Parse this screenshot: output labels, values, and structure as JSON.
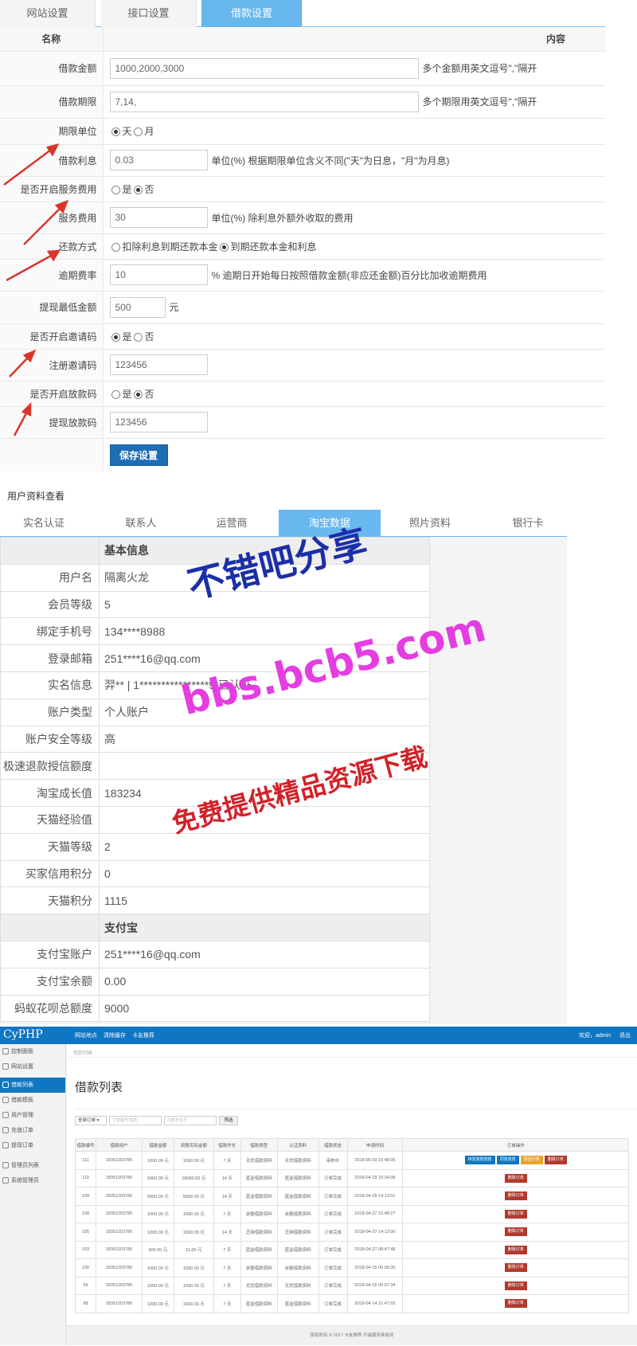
{
  "settings": {
    "tabs": [
      "网站设置",
      "接口设置",
      "借款设置"
    ],
    "header": {
      "name": "名称",
      "content": "内容"
    },
    "amount": {
      "label": "借款金额",
      "value": "1000,2000,3000",
      "hint": "多个金额用英文逗号\",\"隔开"
    },
    "period": {
      "label": "借款期限",
      "value": "7,14,",
      "hint": "多个期限用英文逗号\",\"隔开"
    },
    "unit": {
      "label": "期限单位",
      "opt1": "天",
      "opt2": "月"
    },
    "interest": {
      "label": "借款利息",
      "value": "0.03",
      "hint": "单位(%) 根据期限单位含义不同(\"天\"为日息，\"月\"为月息)"
    },
    "service_enabled": {
      "label": "是否开启服务费用",
      "opt1": "是",
      "opt2": "否"
    },
    "service_fee": {
      "label": "服务费用",
      "value": "30",
      "hint": "单位(%) 除利息外额外收取的费用"
    },
    "repay": {
      "label": "还款方式",
      "opt1": "扣除利息到期还款本金",
      "opt2": "到期还款本金和利息"
    },
    "overdue": {
      "label": "逾期费率",
      "value": "10",
      "hint": "% 逾期日开始每日按照借款金额(非应还金额)百分比加收逾期费用"
    },
    "min_withdraw": {
      "label": "提现最低金额",
      "value": "500",
      "unit": "元"
    },
    "invite_enabled": {
      "label": "是否开启邀请码",
      "opt1": "是",
      "opt2": "否"
    },
    "invite_code": {
      "label": "注册邀请码",
      "value": "123456"
    },
    "release_enabled": {
      "label": "是否开启放款码",
      "opt1": "是",
      "opt2": "否"
    },
    "release_code": {
      "label": "提现放款码",
      "value": "123456"
    },
    "save_label": "保存设置"
  },
  "profile": {
    "title": "用户资料查看",
    "tabs": [
      "实名认证",
      "联系人",
      "运营商",
      "淘宝数据",
      "照片资料",
      "银行卡"
    ],
    "section1": "基本信息",
    "rows1": [
      {
        "k": "用户名",
        "v": "隔离火龙"
      },
      {
        "k": "会员等级",
        "v": "5"
      },
      {
        "k": "绑定手机号",
        "v": "134****8988"
      },
      {
        "k": "登录邮箱",
        "v": "251****16@qq.com"
      },
      {
        "k": "实名信息",
        "v": "羿** | 1****************9 已认证"
      },
      {
        "k": "账户类型",
        "v": "个人账户"
      },
      {
        "k": "账户安全等级",
        "v": "高"
      },
      {
        "k": "极速退款授信额度",
        "v": ""
      },
      {
        "k": "淘宝成长值",
        "v": "183234"
      },
      {
        "k": "天猫经验值",
        "v": ""
      },
      {
        "k": "天猫等级",
        "v": "2"
      },
      {
        "k": "买家信用积分",
        "v": "0"
      },
      {
        "k": "天猫积分",
        "v": "1115"
      }
    ],
    "section2": "支付宝",
    "rows2": [
      {
        "k": "支付宝账户",
        "v": "251****16@qq.com"
      },
      {
        "k": "支付宝余额",
        "v": "0.00"
      },
      {
        "k": "蚂蚁花呗总额度",
        "v": "9000"
      }
    ]
  },
  "watermark": {
    "line1": "不错吧分享",
    "line2": "bbs.bcb5.com",
    "line3": "免费提供精品资源下载"
  },
  "admin": {
    "logo": "CyPHP",
    "topnav": [
      "网站地点",
      "清除缓存",
      "卡友推荐"
    ],
    "welcome": "欢迎，admin",
    "logout": "退出",
    "breadcrumb": "借款列表",
    "page_title": "借款列表",
    "filter": {
      "select": "全部订单 ▾",
      "ph1": "订单编号/借款",
      "ph2": "注册手机号",
      "button": "筛选"
    },
    "sidebar": [
      "控制面板",
      "网站设置",
      "借款列表",
      "借款模板",
      "用户管理",
      "充值订单",
      "提现订单",
      "管理员列表",
      "系统管理员"
    ],
    "columns": [
      "借款编号",
      "借款用户",
      "借款金额",
      "到账实际金额",
      "借款时长",
      "借款类型",
      "认证资料",
      "借款状态",
      "申请时间",
      "订单操作"
    ],
    "rows": [
      [
        "111",
        "18351203780",
        "1000.00 元",
        "1000.00 元",
        "7 天",
        "无忧借款资料",
        "无忧借款资料",
        "审核中",
        "2018-05-03 15:48:06"
      ],
      [
        "110",
        "18351203780",
        "5000.00 元",
        "18000.00 元",
        "14 天",
        "蓝金借款资料",
        "蓝金借款资料",
        "订单完成",
        "2018-04-29 15:34:08"
      ],
      [
        "109",
        "18351203780",
        "5000.00 元",
        "5000.00 元",
        "14 天",
        "蓝金借款资料",
        "蓝金借款资料",
        "订单完成",
        "2018-04-29 14:13:01"
      ],
      [
        "108",
        "18351203780",
        "1000.00 元",
        "1000.00 元",
        "7 天",
        "余额借款资料",
        "余额借款资料",
        "订单完成",
        "2018-04-27 15:48:27"
      ],
      [
        "105",
        "18351203780",
        "1000.00 元",
        "1000.00 元",
        "14 天",
        "芝麻借款资料",
        "芝麻借款资料",
        "订单完成",
        "2018-04-27 14:13:00"
      ],
      [
        "103",
        "18351203780",
        "500.00 元",
        "11.00 元",
        "7 天",
        "蓝金借款资料",
        "蓝金借款资料",
        "订单完成",
        "2018-04-27 08:47:48"
      ],
      [
        "100",
        "18351203780",
        "1000.00 元",
        "1000.00 元",
        "7 天",
        "余额借款资料",
        "余额借款资料",
        "订单完成",
        "2018-04-15 00:09:30"
      ],
      [
        "99",
        "18351203780",
        "1000.00 元",
        "1000.00 元",
        "7 天",
        "无忧借款资料",
        "无忧借款资料",
        "订单完成",
        "2018-04-15 00:07:34"
      ],
      [
        "98",
        "18351203780",
        "1000.00 元",
        "1000.00 元",
        "7 天",
        "蓝金借款资料",
        "蓝金借款资料",
        "订单完成",
        "2018-04-14 21:47:02"
      ]
    ],
    "actions": [
      "待发放款借款",
      "同意放款",
      "驳回订单",
      "删除订单"
    ],
    "delete_label": "删除订单",
    "footer": "版权所有 © 2017 卡友推荐 升级服务商收到"
  },
  "colors": {
    "accent": "#0e76c2",
    "tab": "#69b8ef",
    "danger": "#b03a2e",
    "warn": "#e9a431",
    "save": "#1f6db4",
    "arrow": "#d9362b"
  }
}
